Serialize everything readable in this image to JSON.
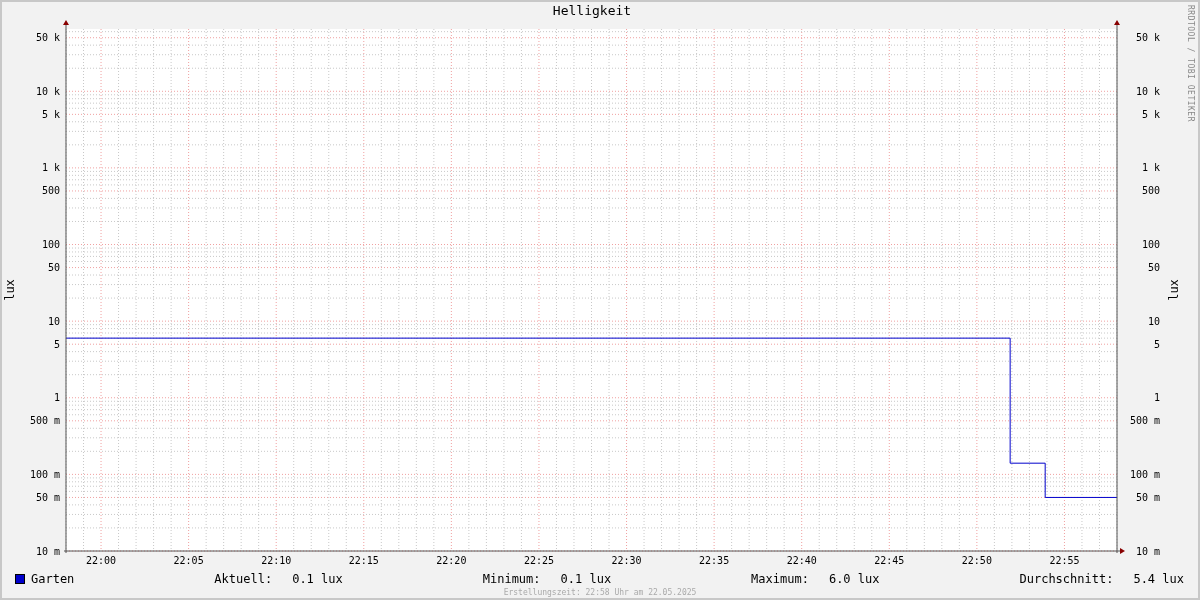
{
  "title": "Helligkeit",
  "credit": "RRDTOOL / TOBI OETIKER",
  "plot": {
    "ylabel": "lux",
    "right_ylabel": "lux",
    "y_axis_labels": [
      "50 k",
      "10 k",
      "5 k",
      "1 k",
      "500",
      "100",
      "50",
      "10",
      "5",
      "1",
      "500 m",
      "100 m",
      "50 m",
      "10 m"
    ],
    "right_axis_labels": [
      "50 k",
      "10 k",
      "5 k",
      "1 k",
      "500",
      "100",
      "50",
      "10",
      "5",
      "1",
      "500 m",
      "100 m",
      "50 m",
      "10 m"
    ],
    "x_axis_labels": [
      "22:00",
      "22:05",
      "22:10",
      "22:15",
      "22:20",
      "22:25",
      "22:30",
      "22:35",
      "22:40",
      "22:45",
      "22:50",
      "22:55"
    ]
  },
  "legend": {
    "name": "Garten",
    "color": "#0000cc"
  },
  "stats": [
    {
      "label": "Aktuell:",
      "value": "0.1 lux"
    },
    {
      "label": "Minimum:",
      "value": "0.1 lux"
    },
    {
      "label": "Maximum:",
      "value": "6.0 lux"
    },
    {
      "label": "Durchschnitt:",
      "value": "5.4 lux"
    }
  ],
  "footer": "Erstellungszeit: 22:58 Uhr am 22.05.2025"
}
